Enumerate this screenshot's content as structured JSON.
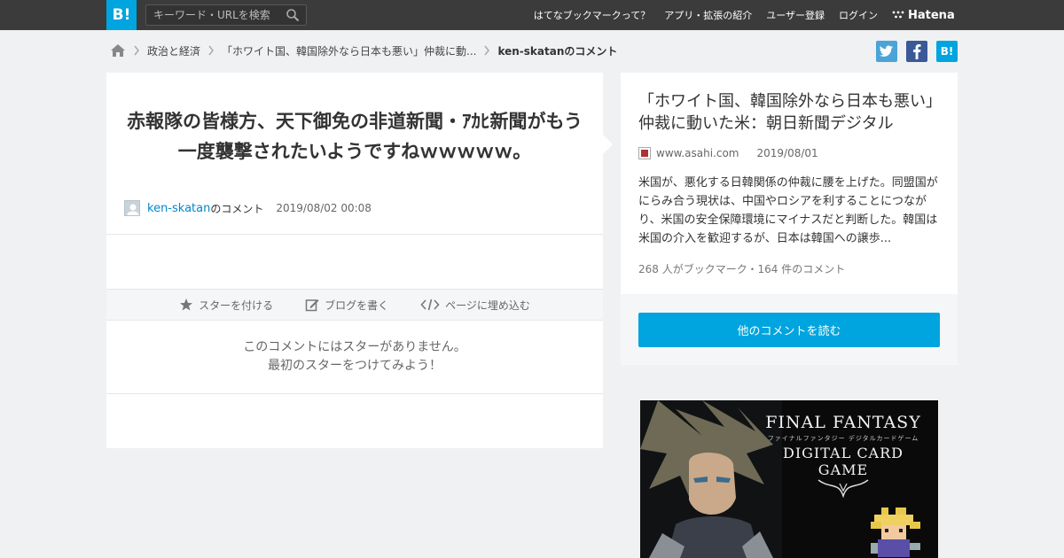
{
  "header": {
    "logo_text": "B!",
    "search_placeholder": "キーワード・URLを検索",
    "nav": [
      "はてなブックマークって？",
      "アプリ・拡張の紹介",
      "ユーザー登録",
      "ログイン"
    ],
    "brand": "Hatena"
  },
  "breadcrumb": {
    "items": [
      "政治と経済",
      "「ホワイト国、韓国除外なら日本も悪い」仲裁に動...",
      "ken-skatanのコメント"
    ]
  },
  "share": {
    "twitter": "t",
    "facebook": "f",
    "hatena": "B!"
  },
  "comment": {
    "text": "赤報隊の皆様方、天下御免の非道新聞・ｱｶﾋ新聞がもう一度襲撃されたいようですねｗｗｗｗｗ。",
    "user": "ken-skatan",
    "user_suffix": "のコメント",
    "date": "2019/08/02 00:08"
  },
  "actions": [
    "スターを付ける",
    "ブログを書く",
    "ページに埋め込む"
  ],
  "no_star": {
    "line1": "このコメントにはスターがありません。",
    "line2": "最初のスターをつけてみよう！"
  },
  "entry": {
    "title": "「ホワイト国、韓国除外なら日本も悪い」仲裁に動いた米：朝日新聞デジタル",
    "domain": "www.asahi.com",
    "date": "2019/08/01",
    "summary": "米国が、悪化する日韓関係の仲裁に腰を上げた。同盟国がにらみ合う現状は、中国やロシアを利することにつながり、米国の安全保障環境にマイナスだと判断した。韓国は米国の介入を歓迎するが、日本は韓国への譲歩...",
    "stats": "268 人がブックマーク・164 件のコメント",
    "read_button": "他のコメントを読む"
  },
  "ad": {
    "line1": "FINAL FANTASY",
    "jp": "ファイナルファンタジー デジタルカードゲーム",
    "line2": "DIGITAL CARD GAME"
  },
  "colors": {
    "accent": "#00a4de",
    "header_bg": "#3b3b3b",
    "twitter": "#4ba3d8",
    "facebook": "#3b5998",
    "link": "#0088cc"
  }
}
